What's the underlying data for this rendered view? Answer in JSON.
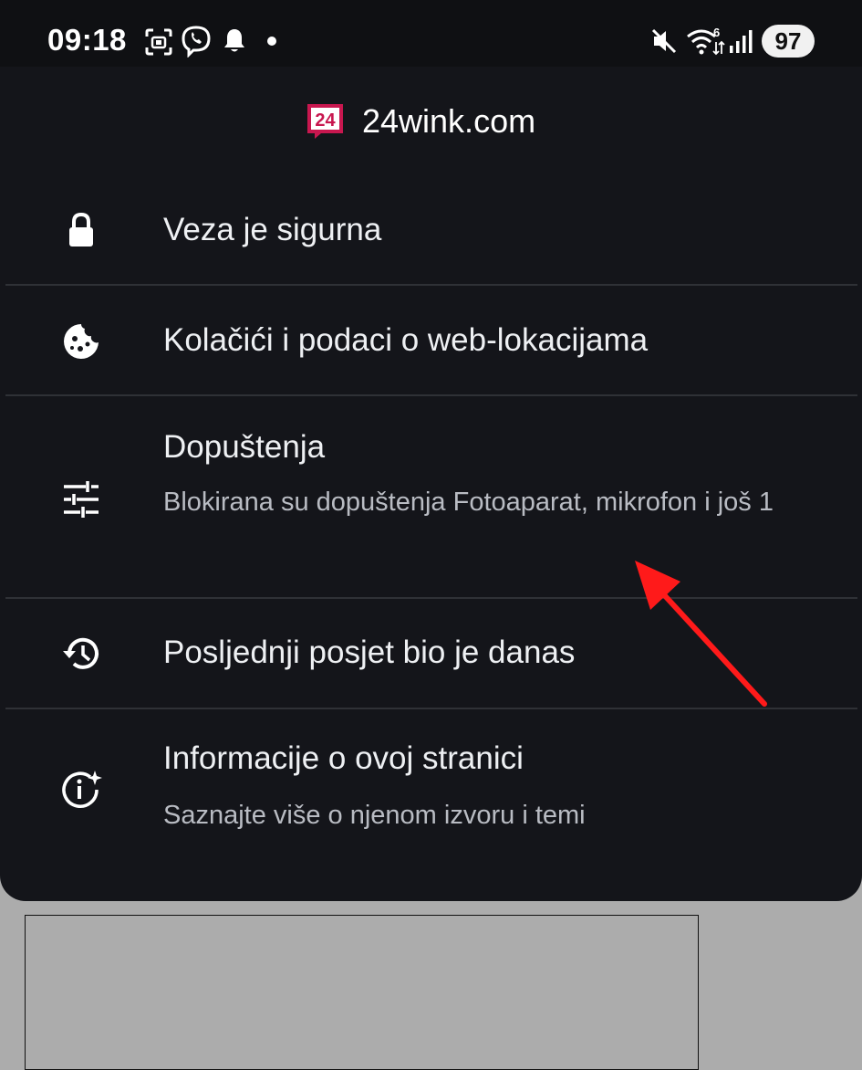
{
  "status_bar": {
    "time": "09:18",
    "battery": "97",
    "icons": [
      "screenshot-icon",
      "viber-icon",
      "bell-icon",
      "dot-icon",
      "mute-icon",
      "wifi-6-icon",
      "signal-icon",
      "battery-icon"
    ]
  },
  "site": {
    "logo_text": "24",
    "name": "24wink.com",
    "logo_color": "#c8174f"
  },
  "menu": {
    "items": [
      {
        "icon": "lock-icon",
        "title": "Veza je sigurna"
      },
      {
        "icon": "cookie-icon",
        "title": "Kolačići i podaci o web-lokacijama"
      },
      {
        "icon": "tune-icon",
        "title": "Dopuštenja",
        "subtitle": "Blokirana su dopuštenja Fotoaparat, mikrofon i još 1"
      },
      {
        "icon": "history-icon",
        "title": "Posljednji posjet bio je danas"
      },
      {
        "icon": "info-sparkle-icon",
        "title": "Informacije o ovoj stranici",
        "subtitle": "Saznajte više o njenom izvoru i temi"
      }
    ]
  },
  "annotation": {
    "arrow_color": "#ff1a1a"
  }
}
